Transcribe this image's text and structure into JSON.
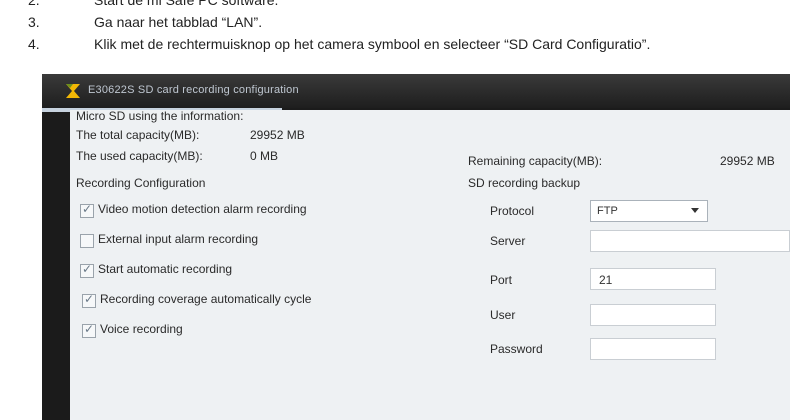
{
  "instructions": [
    {
      "num": "2.",
      "text": "Start de mi Safe PC software."
    },
    {
      "num": "3.",
      "text": "Ga naar het tabblad “LAN”."
    },
    {
      "num": "4.",
      "text": "Klik met de rechtermuisknop op het camera symbool en selecteer “SD Card Configuratio”."
    }
  ],
  "window": {
    "title": "E30622S SD card recording configuration",
    "info_heading": "Micro SD using the information:",
    "total_label": "The total capacity(MB):",
    "total_value": "29952 MB",
    "used_label": "The used capacity(MB):",
    "used_value": "0 MB",
    "remaining_label": "Remaining capacity(MB):",
    "remaining_value": "29952 MB",
    "recording_heading": "Recording Configuration",
    "options": [
      {
        "label": "Video motion detection alarm recording",
        "checked": true
      },
      {
        "label": "External input alarm recording",
        "checked": false
      },
      {
        "label": "Start automatic recording",
        "checked": true
      },
      {
        "label": "Recording coverage automatically cycle",
        "checked": true
      },
      {
        "label": "Voice recording",
        "checked": true
      }
    ],
    "backup_heading": "SD recording backup",
    "protocol_label": "Protocol",
    "protocol_value": "FTP",
    "server_label": "Server",
    "server_value": "",
    "port_label": "Port",
    "port_value": "21",
    "user_label": "User",
    "user_value": "",
    "password_label": "Password",
    "password_value": ""
  },
  "colors": {
    "title_bar": "#1e1e1e",
    "panel": "#eef1f3"
  }
}
